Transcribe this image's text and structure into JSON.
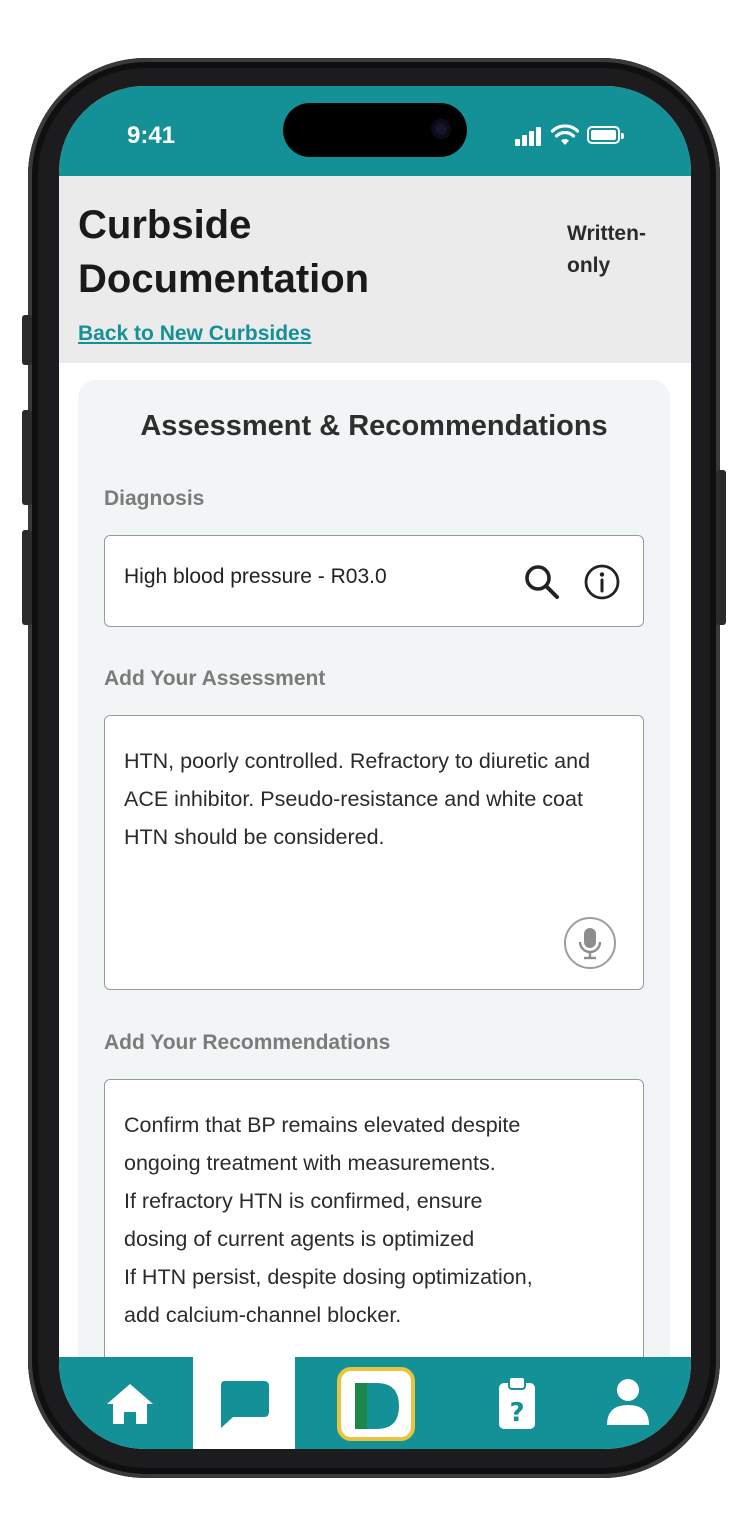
{
  "status_bar": {
    "time": "9:41"
  },
  "header": {
    "title": "Curbside Documentation",
    "mode": "Written-only",
    "back_link": "Back to New Curbsides"
  },
  "card": {
    "title": "Assessment & Recommendations",
    "diagnosis": {
      "label": "Diagnosis",
      "value": "High blood pressure - R03.0",
      "icons": [
        "search-icon",
        "info-icon"
      ]
    },
    "assessment": {
      "label": "Add Your Assessment",
      "value": "HTN, poorly controlled. Refractory to diuretic and ACE inhibitor. Pseudo-resistance and white coat HTN should be considered.",
      "icon": "microphone-icon"
    },
    "recommendations": {
      "label": "Add Your Recommendations",
      "lines": [
        "Confirm that BP remains elevated despite",
        "ongoing treatment with measurements.",
        "If refractory HTN is confirmed, ensure",
        "dosing of current agents is optimized",
        "If HTN persist, despite dosing optimization,",
        "add calcium-channel blocker."
      ]
    }
  },
  "nav": {
    "items": [
      "home-icon",
      "chat-icon",
      "app-logo",
      "clipboard-question-icon",
      "profile-icon"
    ],
    "active": "chat-icon"
  },
  "colors": {
    "teal": "#149196",
    "header_bg": "#ebebeb",
    "card_bg": "#f1f5f5",
    "logo_border": "#e8c33c"
  }
}
